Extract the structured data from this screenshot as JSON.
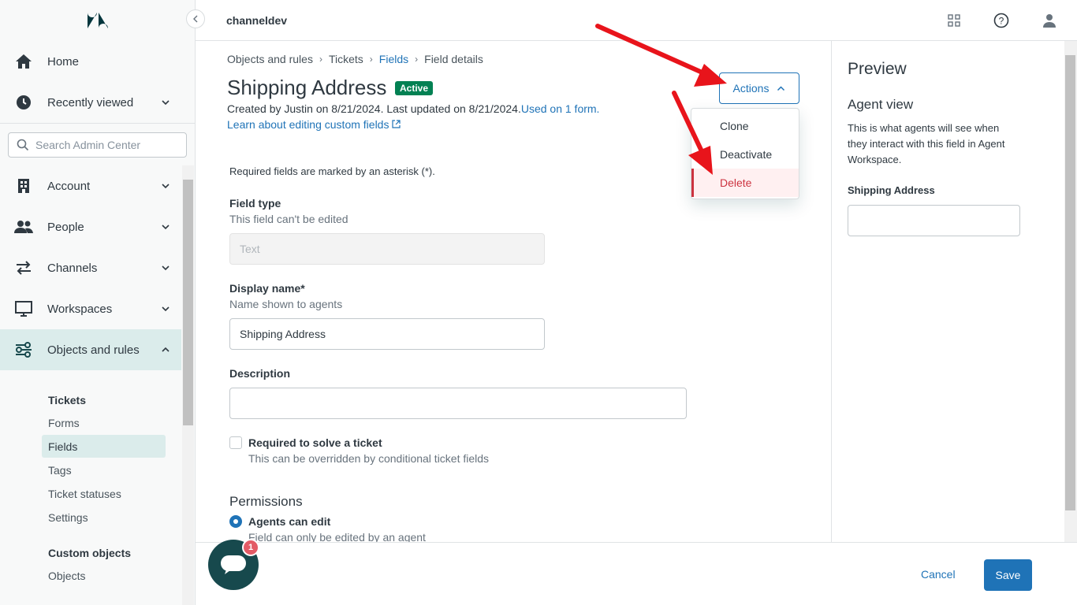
{
  "topbar": {
    "brand": "channeldev"
  },
  "sidebar": {
    "search_placeholder": "Search Admin Center",
    "items": [
      {
        "label": "Home"
      },
      {
        "label": "Recently viewed"
      },
      {
        "label": "Account"
      },
      {
        "label": "People"
      },
      {
        "label": "Channels"
      },
      {
        "label": "Workspaces"
      },
      {
        "label": "Objects and rules"
      }
    ],
    "sub_heading_tickets": "Tickets",
    "sub_items": [
      "Forms",
      "Fields",
      "Tags",
      "Ticket statuses",
      "Settings"
    ],
    "sub_heading_custom": "Custom objects",
    "sub_custom_items": [
      "Objects"
    ]
  },
  "breadcrumb": [
    "Objects and rules",
    "Tickets",
    "Fields",
    "Field details"
  ],
  "page": {
    "title": "Shipping Address",
    "status_badge": "Active",
    "meta_text": "Created by Justin on 8/21/2024. Last updated on 8/21/2024.",
    "meta_link": "Used on 1 form.",
    "learn_link": "Learn about editing custom fields",
    "required_note": "Required fields are marked by an asterisk (*).",
    "field_type_label": "Field type",
    "field_type_hint": "This field can't be edited",
    "field_type_value": "Text",
    "display_name_label": "Display name*",
    "display_name_hint": "Name shown to agents",
    "display_name_value": "Shipping Address",
    "description_label": "Description",
    "description_value": "",
    "required_label": "Required to solve a ticket",
    "required_hint": "This can be overridden by conditional ticket fields",
    "permissions_heading": "Permissions",
    "agents_can_edit_label": "Agents can edit",
    "agents_can_edit_hint": "Field can only be edited by an agent"
  },
  "actions": {
    "button_label": "Actions",
    "menu": [
      "Clone",
      "Deactivate",
      "Delete"
    ]
  },
  "preview": {
    "heading": "Preview",
    "subheading": "Agent view",
    "description": "This is what agents will see when they interact with this field in Agent Workspace.",
    "field_label": "Shipping Address"
  },
  "footer": {
    "cancel_label": "Cancel",
    "save_label": "Save"
  },
  "chat": {
    "badge_count": "1"
  },
  "colors": {
    "accent": "#1f73b7",
    "danger": "#cc3340",
    "active_badge": "#038153",
    "arrow": "#e8141b"
  }
}
